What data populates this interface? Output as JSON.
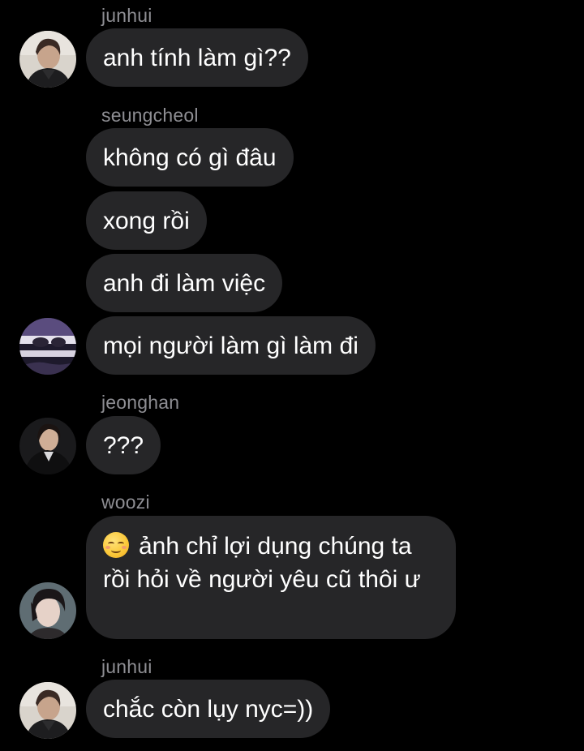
{
  "messages": [
    {
      "sender": "junhui",
      "lines": [
        "anh tính làm gì??"
      ]
    },
    {
      "sender": "seungcheol",
      "lines": [
        "không có gì đâu",
        "xong rồi",
        "anh đi làm việc",
        "mọi người làm gì làm đi"
      ]
    },
    {
      "sender": "jeonghan",
      "lines": [
        "???"
      ]
    },
    {
      "sender": "woozi",
      "emoji": "relieved-smile-icon",
      "text": "ảnh chỉ lợi dụng chúng ta rồi hỏi về người yêu cũ thôi ư"
    },
    {
      "sender": "junhui",
      "lines": [
        "chắc còn lụy nyc=))"
      ]
    }
  ],
  "colors": {
    "background": "#000000",
    "bubble": "#262628",
    "sender_name": "#8e8e93",
    "text": "#ffffff"
  }
}
